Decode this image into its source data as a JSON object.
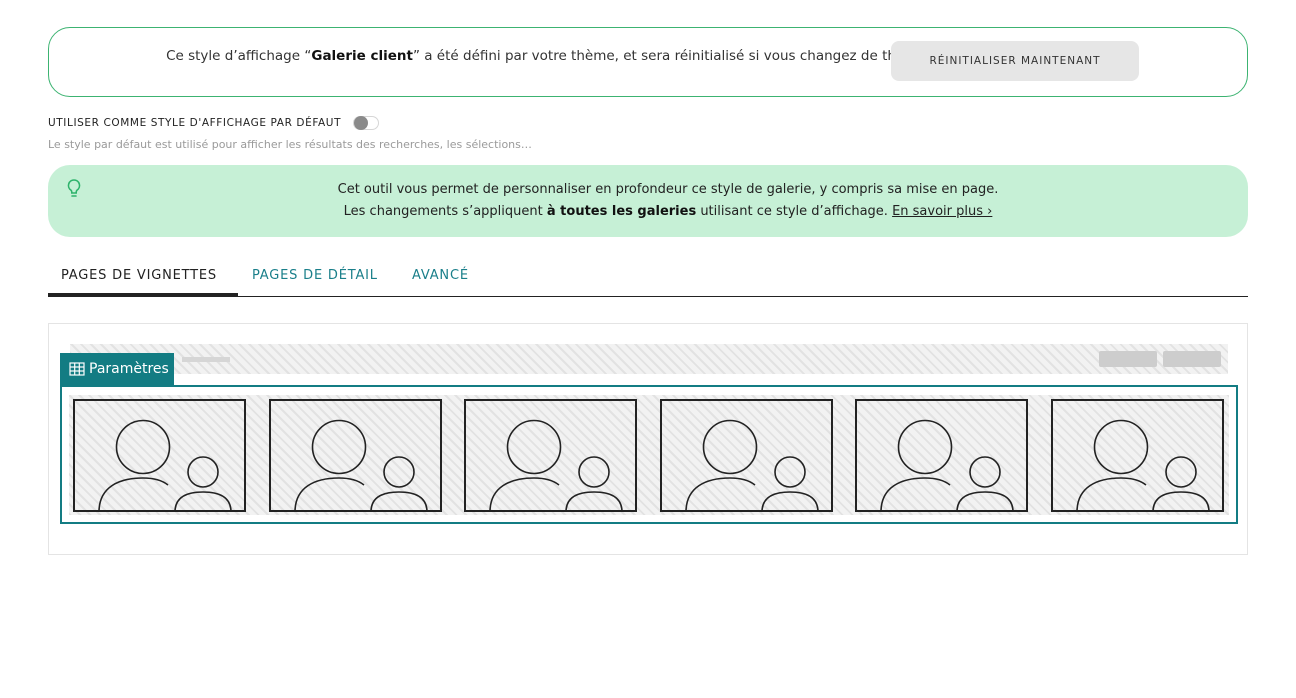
{
  "notice": {
    "prefix": "Ce style d’affichage “",
    "style_name": "Galerie client",
    "suffix": "” a été défini par votre thème, et sera réinitialisé si vous changez de thème.",
    "reset_button": "RÉINITIALISER MAINTENANT",
    "border_color": "#3cb371"
  },
  "default_style": {
    "label": "UTILISER COMME STYLE D'AFFICHAGE PAR DÉFAUT",
    "enabled": false,
    "help": "Le style par défaut est utilisé pour afficher les résultats des recherches, les sélections…"
  },
  "info": {
    "icon": "lightbulb-icon",
    "line1": "Cet outil vous permet de personnaliser en profondeur ce style de galerie, y compris sa mise en page.",
    "line2_prefix": "Les changements s’appliquent ",
    "line2_bold": "à toutes les galeries",
    "line2_suffix": " utilisant ce style d’affichage. ",
    "link": "En savoir plus ›",
    "background": "#c6f0d6"
  },
  "tabs": [
    {
      "label": "PAGES DE VIGNETTES",
      "active": true
    },
    {
      "label": "PAGES DE DÉTAIL",
      "active": false
    },
    {
      "label": "AVANCÉ",
      "active": false
    }
  ],
  "preview": {
    "params_label": "Paramètres",
    "params_icon": "grid-icon",
    "accent": "#137c83",
    "thumbnail_icon": "people-placeholder-icon",
    "thumbnail_count": 6
  }
}
